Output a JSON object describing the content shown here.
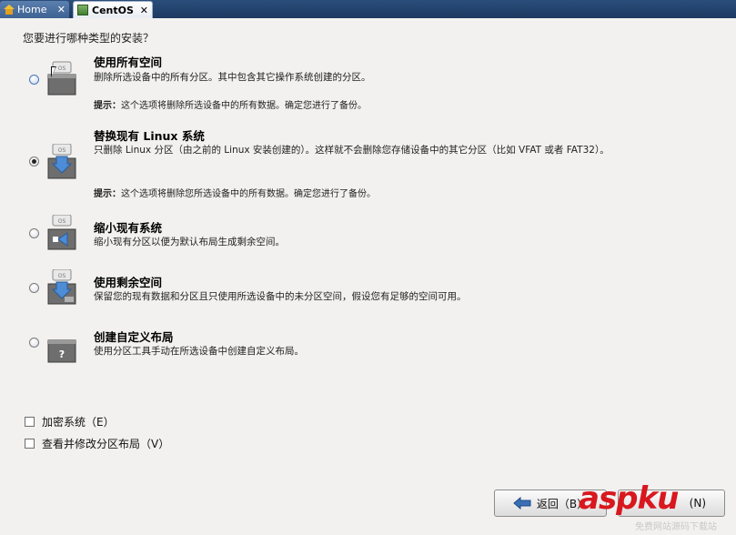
{
  "tabs": [
    {
      "label": "Home",
      "icon": "home-icon"
    },
    {
      "label": "CentOS",
      "icon": "vm-icon"
    }
  ],
  "question": "您要进行哪种类型的安装？",
  "options": [
    {
      "title": "使用所有空间",
      "desc": "删除所选设备中的所有分区。其中包含其它操作系统创建的分区。",
      "hint_label": "提示：",
      "hint": "这个选项将删除所选设备中的所有数据。确定您进行了备份。",
      "icon": "disk-os-icon",
      "selected": false
    },
    {
      "title": "替换现有 Linux 系统",
      "desc": "只删除 Linux 分区（由之前的 Linux 安装创建的）。这样就不会删除您存储设备中的其它分区（比如 VFAT 或者 FAT32）。",
      "hint_label": "提示：",
      "hint": "这个选项将删除您所选设备中的所有数据。确定您进行了备份。",
      "icon": "disk-replace-icon",
      "selected": true
    },
    {
      "title": "缩小现有系统",
      "desc": "缩小现有分区以便为默认布局生成剩余空间。",
      "icon": "disk-shrink-icon",
      "selected": false
    },
    {
      "title": "使用剩余空间",
      "desc": "保留您的现有数据和分区且只使用所选设备中的未分区空间，假设您有足够的空间可用。",
      "icon": "disk-free-icon",
      "selected": false
    },
    {
      "title": "创建自定义布局",
      "desc": "使用分区工具手动在所选设备中创建自定义布局。",
      "icon": "disk-custom-icon",
      "selected": false
    }
  ],
  "checkboxes": [
    {
      "label": "加密系统（E）",
      "checked": false
    },
    {
      "label": "查看并修改分区布局（V）",
      "checked": false
    }
  ],
  "buttons": {
    "back": "返回（B）",
    "next": "(N)"
  },
  "watermark": {
    "main": "aspku",
    "sub": "免费网站源码下载站"
  },
  "colors": {
    "tab_bar": "#1b3a63",
    "background": "#f2f1f0",
    "accent": "#3a6fb5",
    "watermark": "#d8181e"
  }
}
